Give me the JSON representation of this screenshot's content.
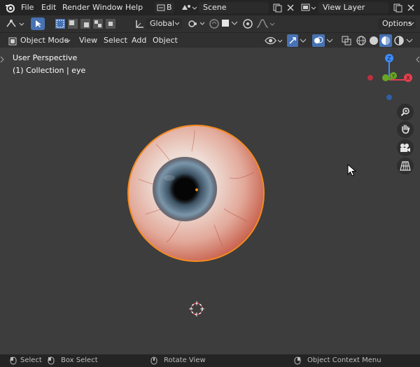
{
  "menubar": {
    "items": [
      {
        "id": "file",
        "label": "File"
      },
      {
        "id": "edit",
        "label": "Edit"
      },
      {
        "id": "render",
        "label": "Render"
      },
      {
        "id": "window",
        "label": "Window"
      },
      {
        "id": "help",
        "label": "Help"
      }
    ],
    "workspace_label": "B",
    "scene": "Scene",
    "view_layer": "View Layer"
  },
  "toolbar": {
    "transform_orientation": "Global",
    "options_label": "Options"
  },
  "header": {
    "mode": "Object Mode",
    "menus": [
      {
        "id": "view",
        "label": "View"
      },
      {
        "id": "select",
        "label": "Select"
      },
      {
        "id": "add",
        "label": "Add"
      },
      {
        "id": "object",
        "label": "Object"
      }
    ]
  },
  "viewport": {
    "perspective_label": "User Perspective",
    "collection_label": "(1) Collection | eye",
    "gizmo": {
      "z": "Z",
      "x": "X",
      "y": "Y"
    }
  },
  "statusbar": {
    "select": "Select",
    "box_select": "Box Select",
    "rotate_view": "Rotate View",
    "context_menu": "Object Context Menu"
  },
  "colors": {
    "accent": "#4772b3",
    "selection_outline": "#f58a20",
    "axis_x": "#e0414f",
    "axis_y": "#6ba524",
    "axis_z": "#3d8cff"
  }
}
